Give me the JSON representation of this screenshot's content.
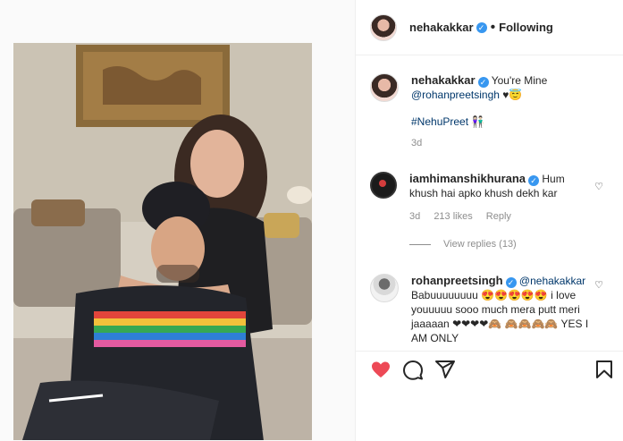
{
  "post": {
    "author": "nehakakkar",
    "follow_label": "Following",
    "dot": "•"
  },
  "caption": {
    "username": "nehakakkar",
    "text_before": "You're Mine",
    "mention": "@rohanpreetsingh",
    "emojis": "♥😇",
    "hashtag": "#NehuPreet",
    "hashtag_emojis": "👫🏻",
    "age": "3d"
  },
  "comments": [
    {
      "username": "iamhimanshikhurana",
      "text": "Hum khush hai apko khush dekh kar",
      "age": "3d",
      "likes": "213 likes",
      "reply": "Reply",
      "view_replies": "View replies (13)"
    },
    {
      "username": "rohanpreetsingh",
      "mention": "@nehakakkar",
      "text_a": "Babuuuuuuuu",
      "emojis_a": "😍😍😍😍😍",
      "text_b": "i love youuuuu sooo much mera putt meri jaaaaan",
      "emojis_b": "❤❤❤❤🙈",
      "emojis_c": "🙈🙈🙈🙈",
      "text_c": "YES I AM ONLY"
    }
  ],
  "icons": {
    "like": "heart-filled-red",
    "comment": "speech-bubble",
    "share": "paper-plane",
    "save": "bookmark",
    "comment_like": "heart-outline"
  },
  "colors": {
    "like_red": "#ed4956",
    "verified_blue": "#3897f0",
    "link": "#00376b",
    "muted": "#8e8e8e"
  }
}
